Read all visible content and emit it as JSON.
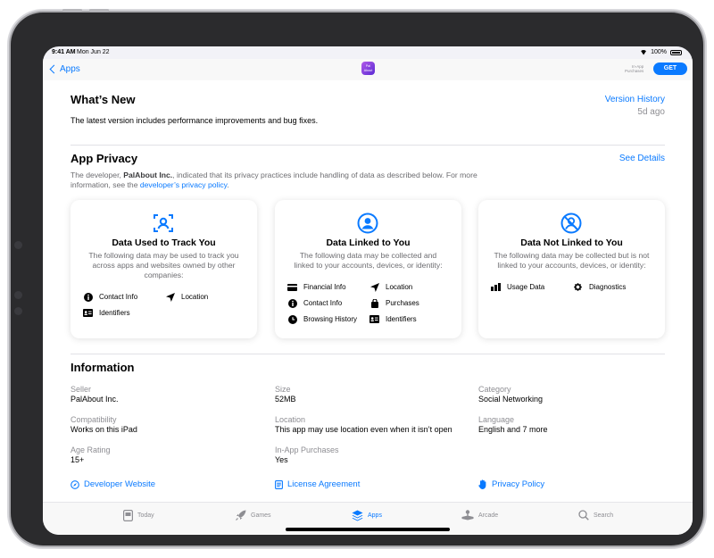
{
  "status": {
    "time": "9:41 AM",
    "date": "Mon Jun 22",
    "battery": "100%"
  },
  "nav": {
    "back_label": "Apps",
    "app_icon_text": "Pal About",
    "in_app_line1": "In-App",
    "in_app_line2": "Purchases",
    "get_label": "GET"
  },
  "whats_new": {
    "title": "What’s New",
    "history_link": "Version History",
    "age": "5d ago",
    "body": "The latest version includes performance improvements and bug fixes."
  },
  "privacy": {
    "title": "App Privacy",
    "details_link": "See Details",
    "desc_prefix": "The developer, ",
    "developer": "PalAbout Inc.",
    "desc_middle": ", indicated that its privacy practices include handling of data as described below. For more information, see the ",
    "policy_link": "developer’s privacy policy",
    "desc_suffix": ".",
    "cards": [
      {
        "title": "Data Used to Track You",
        "desc": "The following data may be used to track you across apps and websites owned by other companies:",
        "items": [
          {
            "label": "Contact Info",
            "icon": "info-circle-icon"
          },
          {
            "label": "Location",
            "icon": "location-arrow-icon"
          },
          {
            "label": "Identifiers",
            "icon": "id-card-icon"
          }
        ]
      },
      {
        "title": "Data Linked to You",
        "desc": "The following data may be collected and linked to your accounts, devices, or identity:",
        "items": [
          {
            "label": "Financial Info",
            "icon": "credit-card-icon"
          },
          {
            "label": "Location",
            "icon": "location-arrow-icon"
          },
          {
            "label": "Contact Info",
            "icon": "info-circle-icon"
          },
          {
            "label": "Purchases",
            "icon": "shopping-bag-icon"
          },
          {
            "label": "Browsing History",
            "icon": "clock-icon"
          },
          {
            "label": "Identifiers",
            "icon": "id-card-icon"
          }
        ]
      },
      {
        "title": "Data Not Linked to You",
        "desc": "The following data may be collected but is not linked to your accounts, devices, or identity:",
        "items": [
          {
            "label": "Usage Data",
            "icon": "bar-chart-icon"
          },
          {
            "label": "Diagnostics",
            "icon": "gear-icon"
          }
        ]
      }
    ]
  },
  "information": {
    "title": "Information",
    "fields": [
      {
        "label": "Seller",
        "value": "PalAbout Inc."
      },
      {
        "label": "Size",
        "value": "52MB"
      },
      {
        "label": "Category",
        "value": "Social Networking"
      },
      {
        "label": "Compatibility",
        "value": "Works on this iPad"
      },
      {
        "label": "Location",
        "value": "This app may use location even when it isn’t open"
      },
      {
        "label": "Language",
        "value": "English and 7 more"
      },
      {
        "label": "Age Rating",
        "value": "15+"
      },
      {
        "label": "In-App Purchases",
        "value": "Yes"
      }
    ],
    "links": [
      {
        "label": "Developer Website",
        "icon": "compass-icon"
      },
      {
        "label": "License Agreement",
        "icon": "document-icon"
      },
      {
        "label": "Privacy Policy",
        "icon": "hand-icon"
      }
    ]
  },
  "tabs": [
    {
      "label": "Today",
      "icon": "today-icon"
    },
    {
      "label": "Games",
      "icon": "rocket-icon"
    },
    {
      "label": "Apps",
      "icon": "layers-icon",
      "active": true
    },
    {
      "label": "Arcade",
      "icon": "joystick-icon"
    },
    {
      "label": "Search",
      "icon": "search-icon"
    }
  ],
  "colors": {
    "accent": "#0a7aff",
    "secondary_text": "#8e8e93"
  }
}
